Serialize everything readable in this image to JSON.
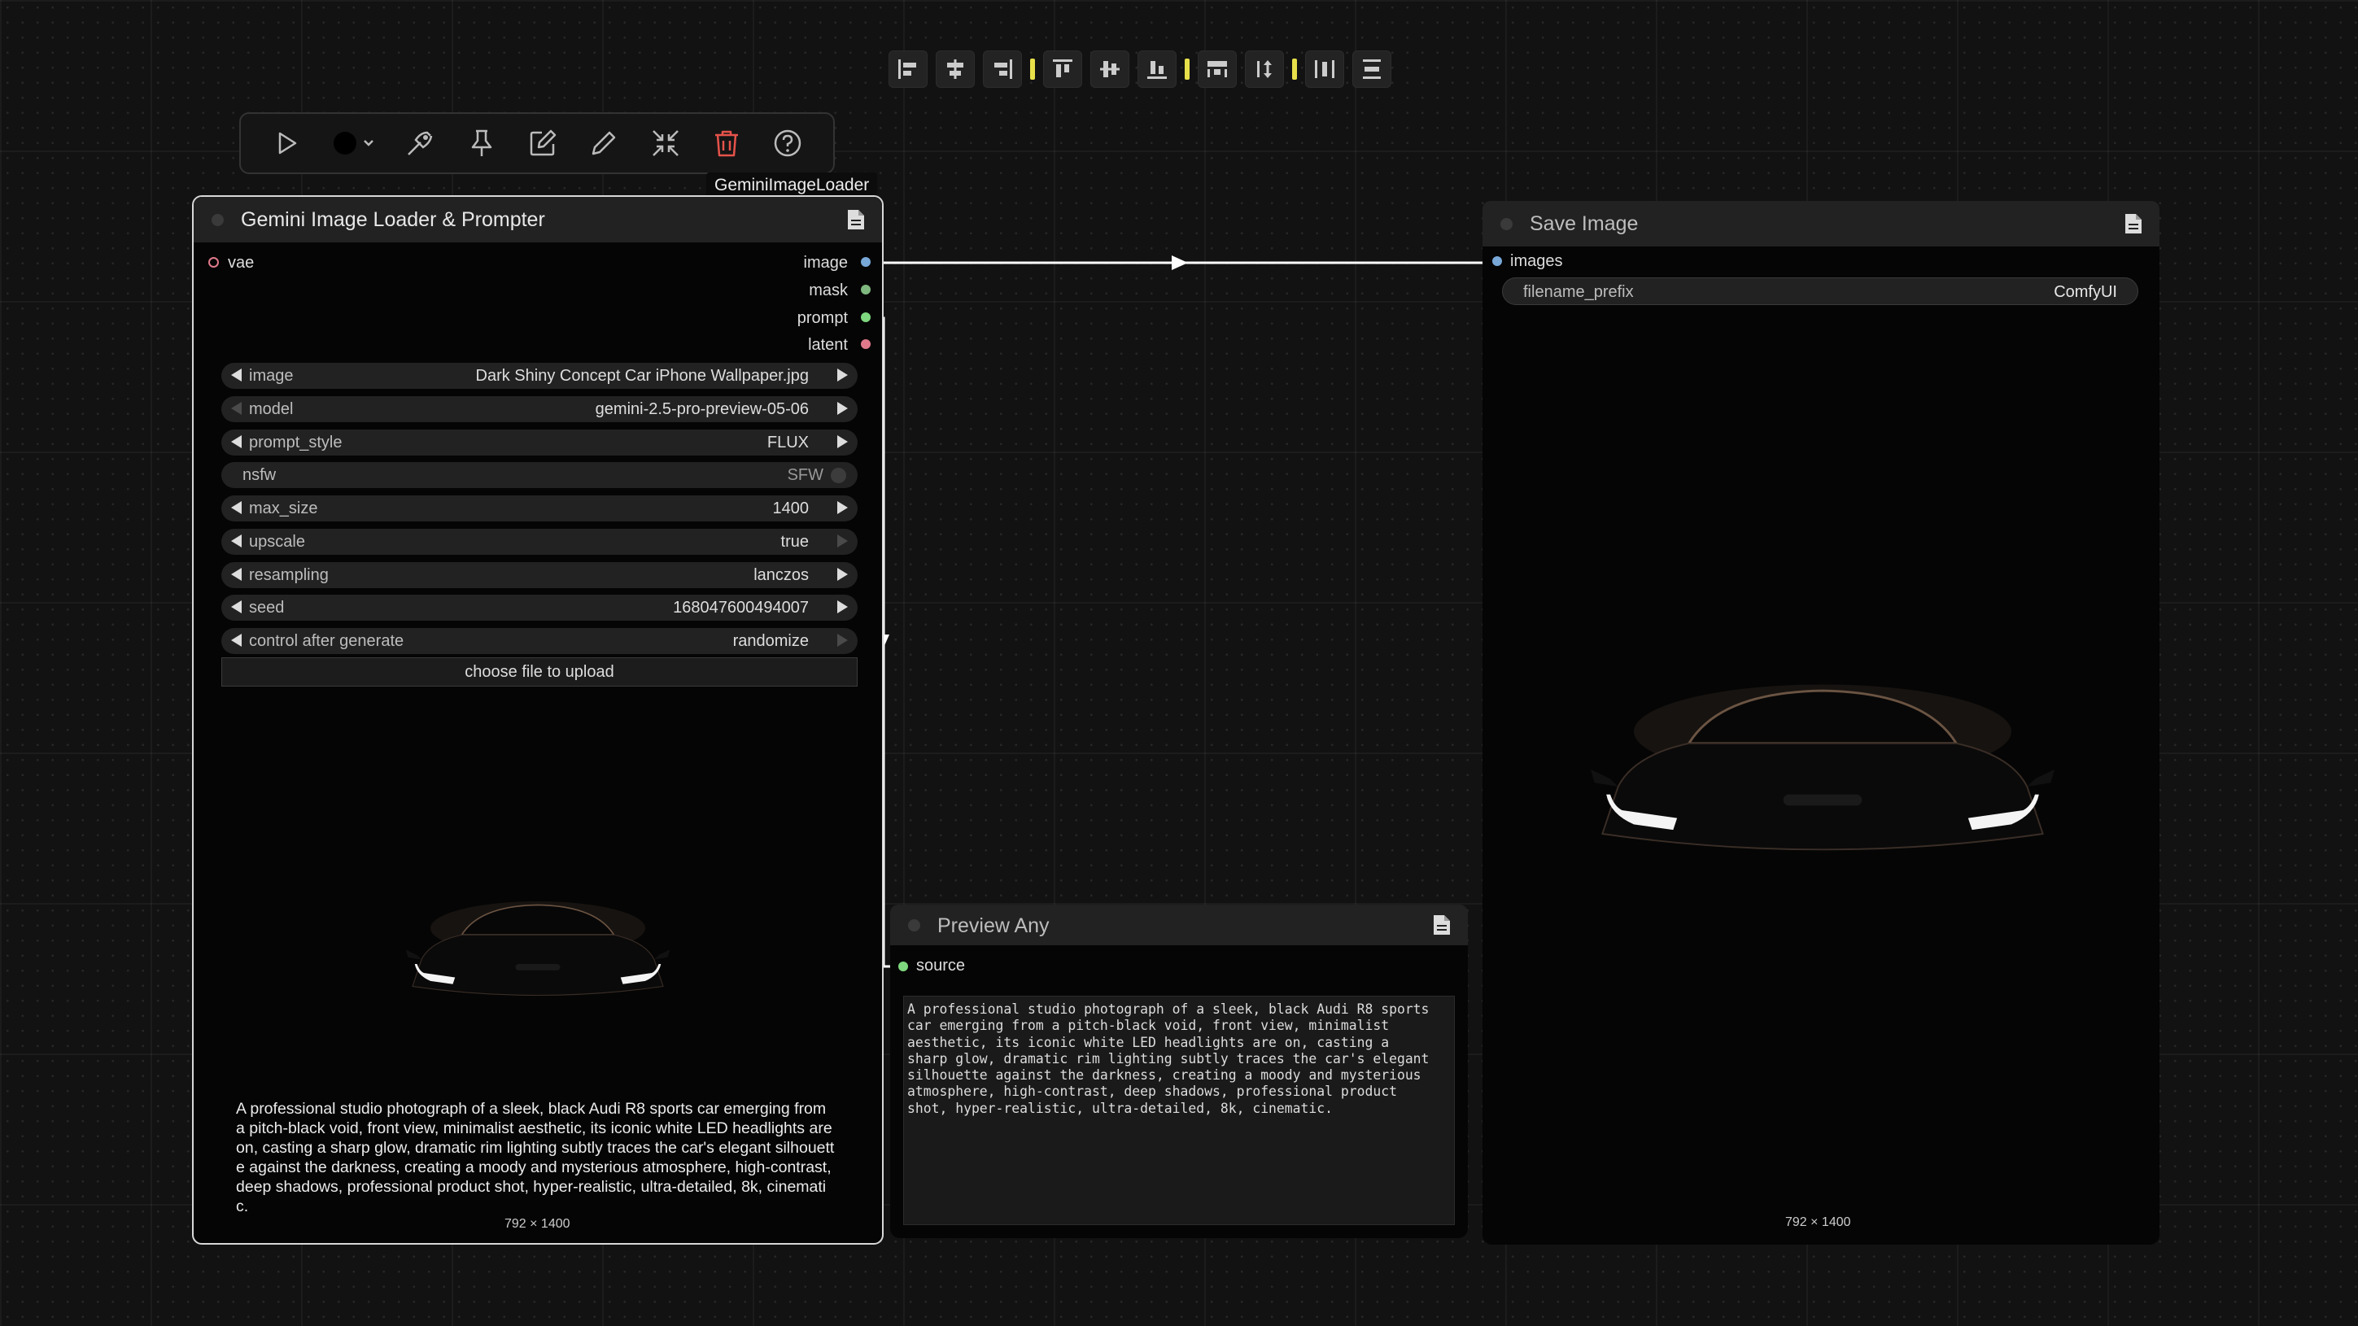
{
  "align_toolbar": {
    "buttons": [
      {
        "name": "align-left-icon"
      },
      {
        "name": "align-center-horizontal-icon"
      },
      {
        "name": "align-right-icon"
      },
      {
        "name": "align-top-icon"
      },
      {
        "name": "align-center-vertical-icon"
      },
      {
        "name": "align-bottom-icon"
      },
      {
        "name": "distribute-horizontal-icon"
      },
      {
        "name": "distribute-vertical-icon"
      },
      {
        "name": "distribute-width-icon"
      },
      {
        "name": "distribute-height-icon"
      }
    ],
    "separator_color": "#e7e04a"
  },
  "node_toolbar": {
    "tools": [
      "play-icon",
      "color-picker-icon",
      "bypass-icon",
      "pin-icon",
      "edit-icon",
      "pencil-icon",
      "collapse-icon",
      "trash-icon",
      "help-icon"
    ],
    "tooltip": "GeminiImageLoader"
  },
  "loader_node": {
    "title": "Gemini Image Loader & Prompter",
    "input_slots": [
      {
        "label": "vae",
        "color": "#e07a8a"
      }
    ],
    "output_slots": [
      {
        "label": "image",
        "color": "#78a8d8"
      },
      {
        "label": "mask",
        "color": "#7fb87f"
      },
      {
        "label": "prompt",
        "color": "#7fd87f"
      },
      {
        "label": "latent",
        "color": "#e07a8a"
      }
    ],
    "widgets": {
      "image": {
        "label": "image",
        "value": "Dark Shiny Concept Car iPhone Wallpaper.jpg"
      },
      "model": {
        "label": "model",
        "value": "gemini-2.5-pro-preview-05-06"
      },
      "prompt_style": {
        "label": "prompt_style",
        "value": "FLUX"
      },
      "nsfw": {
        "label": "nsfw",
        "value": "SFW"
      },
      "max_size": {
        "label": "max_size",
        "value": "1400"
      },
      "upscale": {
        "label": "upscale",
        "value": "true"
      },
      "resampling": {
        "label": "resampling",
        "value": "lanczos"
      },
      "seed": {
        "label": "seed",
        "value": "168047600494007"
      },
      "control_after_generate": {
        "label": "control after generate",
        "value": "randomize"
      }
    },
    "upload_button": "choose file to upload",
    "generated_prompt": "A professional studio photograph of a sleek, black Audi R8 sports car emerging from a pitch-black void, front view, minimalist aesthetic, its iconic white LED headlights are on, casting a sharp glow, dramatic rim lighting subtly traces the car's elegant silhouette against the darkness, creating a moody and mysterious atmosphere, high-contrast, deep shadows, professional product shot, hyper-realistic, ultra-detailed, 8k, cinematic.",
    "image_dims": "792 × 1400"
  },
  "save_node": {
    "title": "Save Image",
    "input_slots": [
      {
        "label": "images",
        "color": "#78a8d8"
      }
    ],
    "filename_prefix": {
      "label": "filename_prefix",
      "value": "ComfyUI"
    },
    "image_dims": "792 × 1400"
  },
  "preview_node": {
    "title": "Preview Any",
    "input_slots": [
      {
        "label": "source",
        "color": "#7fd87f"
      }
    ],
    "text": "A professional studio photograph of a sleek, black Audi R8 sports\ncar emerging from a pitch-black void, front view, minimalist\naesthetic, its iconic white LED headlights are on, casting a\nsharp glow, dramatic rim lighting subtly traces the car's elegant\nsilhouette against the darkness, creating a moody and mysterious\natmosphere, high-contrast, deep shadows, professional product\nshot, hyper-realistic, ultra-detailed, 8k, cinematic."
  }
}
